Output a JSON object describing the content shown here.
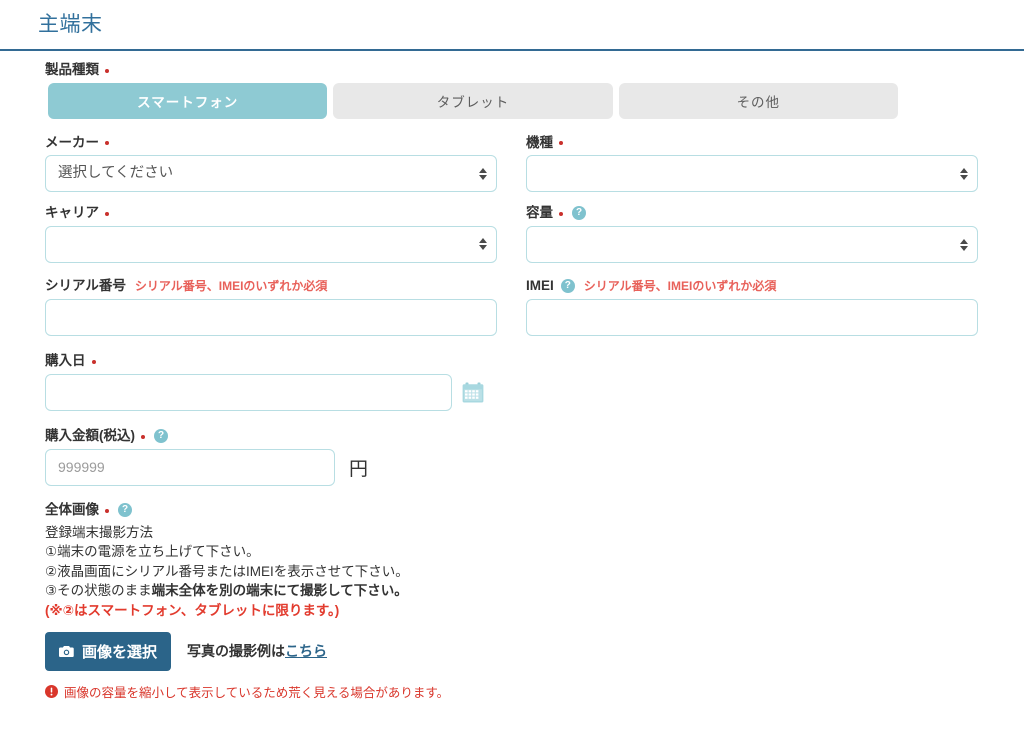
{
  "header": {
    "title": "主端末"
  },
  "product_type": {
    "label": "製品種類",
    "options": [
      {
        "label": "スマートフォン",
        "selected": true
      },
      {
        "label": "タブレット",
        "selected": false
      },
      {
        "label": "その他",
        "selected": false
      }
    ]
  },
  "fields": {
    "maker": {
      "label": "メーカー",
      "value": "選択してください"
    },
    "model": {
      "label": "機種",
      "value": ""
    },
    "carrier": {
      "label": "キャリア",
      "value": ""
    },
    "capacity": {
      "label": "容量",
      "help": "?",
      "value": ""
    },
    "serial": {
      "label": "シリアル番号",
      "hint": "シリアル番号、IMEIのいずれか必須",
      "value": "",
      "placeholder": ""
    },
    "imei": {
      "label": "IMEI",
      "help": "?",
      "hint": "シリアル番号、IMEIのいずれか必須",
      "value": "",
      "placeholder": ""
    },
    "purchase_date": {
      "label": "購入日",
      "value": "",
      "placeholder": ""
    },
    "purchase_price": {
      "label": "購入金額(税込)",
      "help": "?",
      "value": "",
      "placeholder": "999999",
      "unit": "円"
    }
  },
  "whole_image": {
    "label": "全体画像",
    "help": "?",
    "instructions": {
      "heading": "登録端末撮影方法",
      "line1": "①端末の電源を立ち上げて下さい。",
      "line2": "②液晶画面にシリアル番号またはIMEIを表示させて下さい。",
      "line3_plain": "③その状態のまま",
      "line3_bold": "端末全体を別の端末にて撮影して下さい。",
      "warning": "(※②はスマートフォン、タブレットに限ります。)"
    },
    "select_button": "画像を選択",
    "example_text": "写真の撮影例は",
    "example_link": "こちら",
    "notice": "画像の容量を縮小して表示しているため荒く見える場合があります。"
  },
  "colors": {
    "title_blue": "#31709c",
    "accent_teal": "#8ecad3",
    "input_border": "#b8dee3",
    "required_red": "#c9302c",
    "hint_red": "#e8615a",
    "warn_red": "#e23b2e",
    "button_blue": "#2b6489"
  }
}
